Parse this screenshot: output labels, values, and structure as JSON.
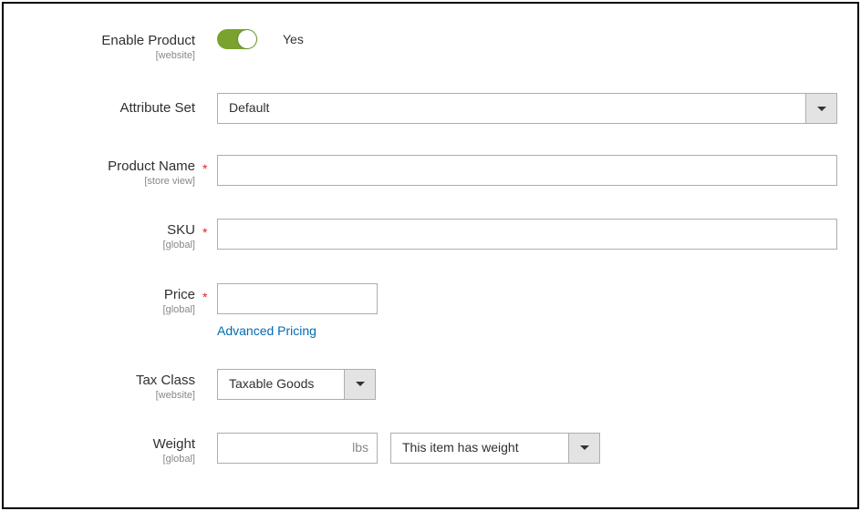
{
  "enable_product": {
    "label": "Enable Product",
    "scope": "[website]",
    "value_label": "Yes"
  },
  "attribute_set": {
    "label": "Attribute Set",
    "value": "Default"
  },
  "product_name": {
    "label": "Product Name",
    "scope": "[store view]",
    "value": ""
  },
  "sku": {
    "label": "SKU",
    "scope": "[global]",
    "value": ""
  },
  "price": {
    "label": "Price",
    "scope": "[global]",
    "prefix": "$",
    "value": "",
    "advanced_link": "Advanced Pricing"
  },
  "tax_class": {
    "label": "Tax Class",
    "scope": "[website]",
    "value": "Taxable Goods"
  },
  "weight": {
    "label": "Weight",
    "scope": "[global]",
    "value": "",
    "unit": "lbs",
    "has_weight_value": "This item has weight"
  }
}
